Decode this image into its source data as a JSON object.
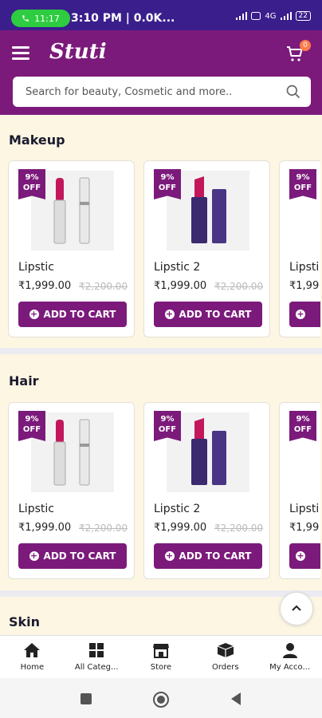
{
  "status_bar": {
    "call_time": "11:17",
    "clock": "3:10 PM | 0.0K...",
    "network": "4G",
    "battery": "22"
  },
  "header": {
    "logo": "Stuti",
    "cart_count": "0"
  },
  "search": {
    "placeholder": "Search for beauty, Cosmetic and more.."
  },
  "sections": [
    {
      "title": "Makeup",
      "products": [
        {
          "discount_pct": "9%",
          "discount_label": "OFF",
          "name": "Lipstic",
          "price": "₹1,999.00",
          "mrp": "₹2,200.00",
          "button": "ADD TO CART"
        },
        {
          "discount_pct": "9%",
          "discount_label": "OFF",
          "name": "Lipstic 2",
          "price": "₹1,999.00",
          "mrp": "₹2,200.00",
          "button": "ADD TO CART"
        },
        {
          "discount_pct": "9%",
          "discount_label": "OFF",
          "name": "Lipsti",
          "price": "₹1,99"
        }
      ]
    },
    {
      "title": "Hair",
      "products": [
        {
          "discount_pct": "9%",
          "discount_label": "OFF",
          "name": "Lipstic",
          "price": "₹1,999.00",
          "mrp": "₹2,200.00",
          "button": "ADD TO CART"
        },
        {
          "discount_pct": "9%",
          "discount_label": "OFF",
          "name": "Lipstic 2",
          "price": "₹1,999.00",
          "mrp": "₹2,200.00",
          "button": "ADD TO CART"
        },
        {
          "discount_pct": "9%",
          "discount_label": "OFF",
          "name": "Lipsti",
          "price": "₹1,99"
        }
      ]
    },
    {
      "title": "Skin"
    }
  ],
  "bottom_nav": [
    {
      "label": "Home",
      "icon": "home-icon"
    },
    {
      "label": "All Categ...",
      "icon": "grid-icon"
    },
    {
      "label": "Store",
      "icon": "store-icon"
    },
    {
      "label": "Orders",
      "icon": "box-icon"
    },
    {
      "label": "My Acco...",
      "icon": "user-icon"
    }
  ],
  "colors": {
    "brand": "#7b1a7b",
    "status_bar": "#3a1e8c",
    "background": "#fdf6e3"
  }
}
